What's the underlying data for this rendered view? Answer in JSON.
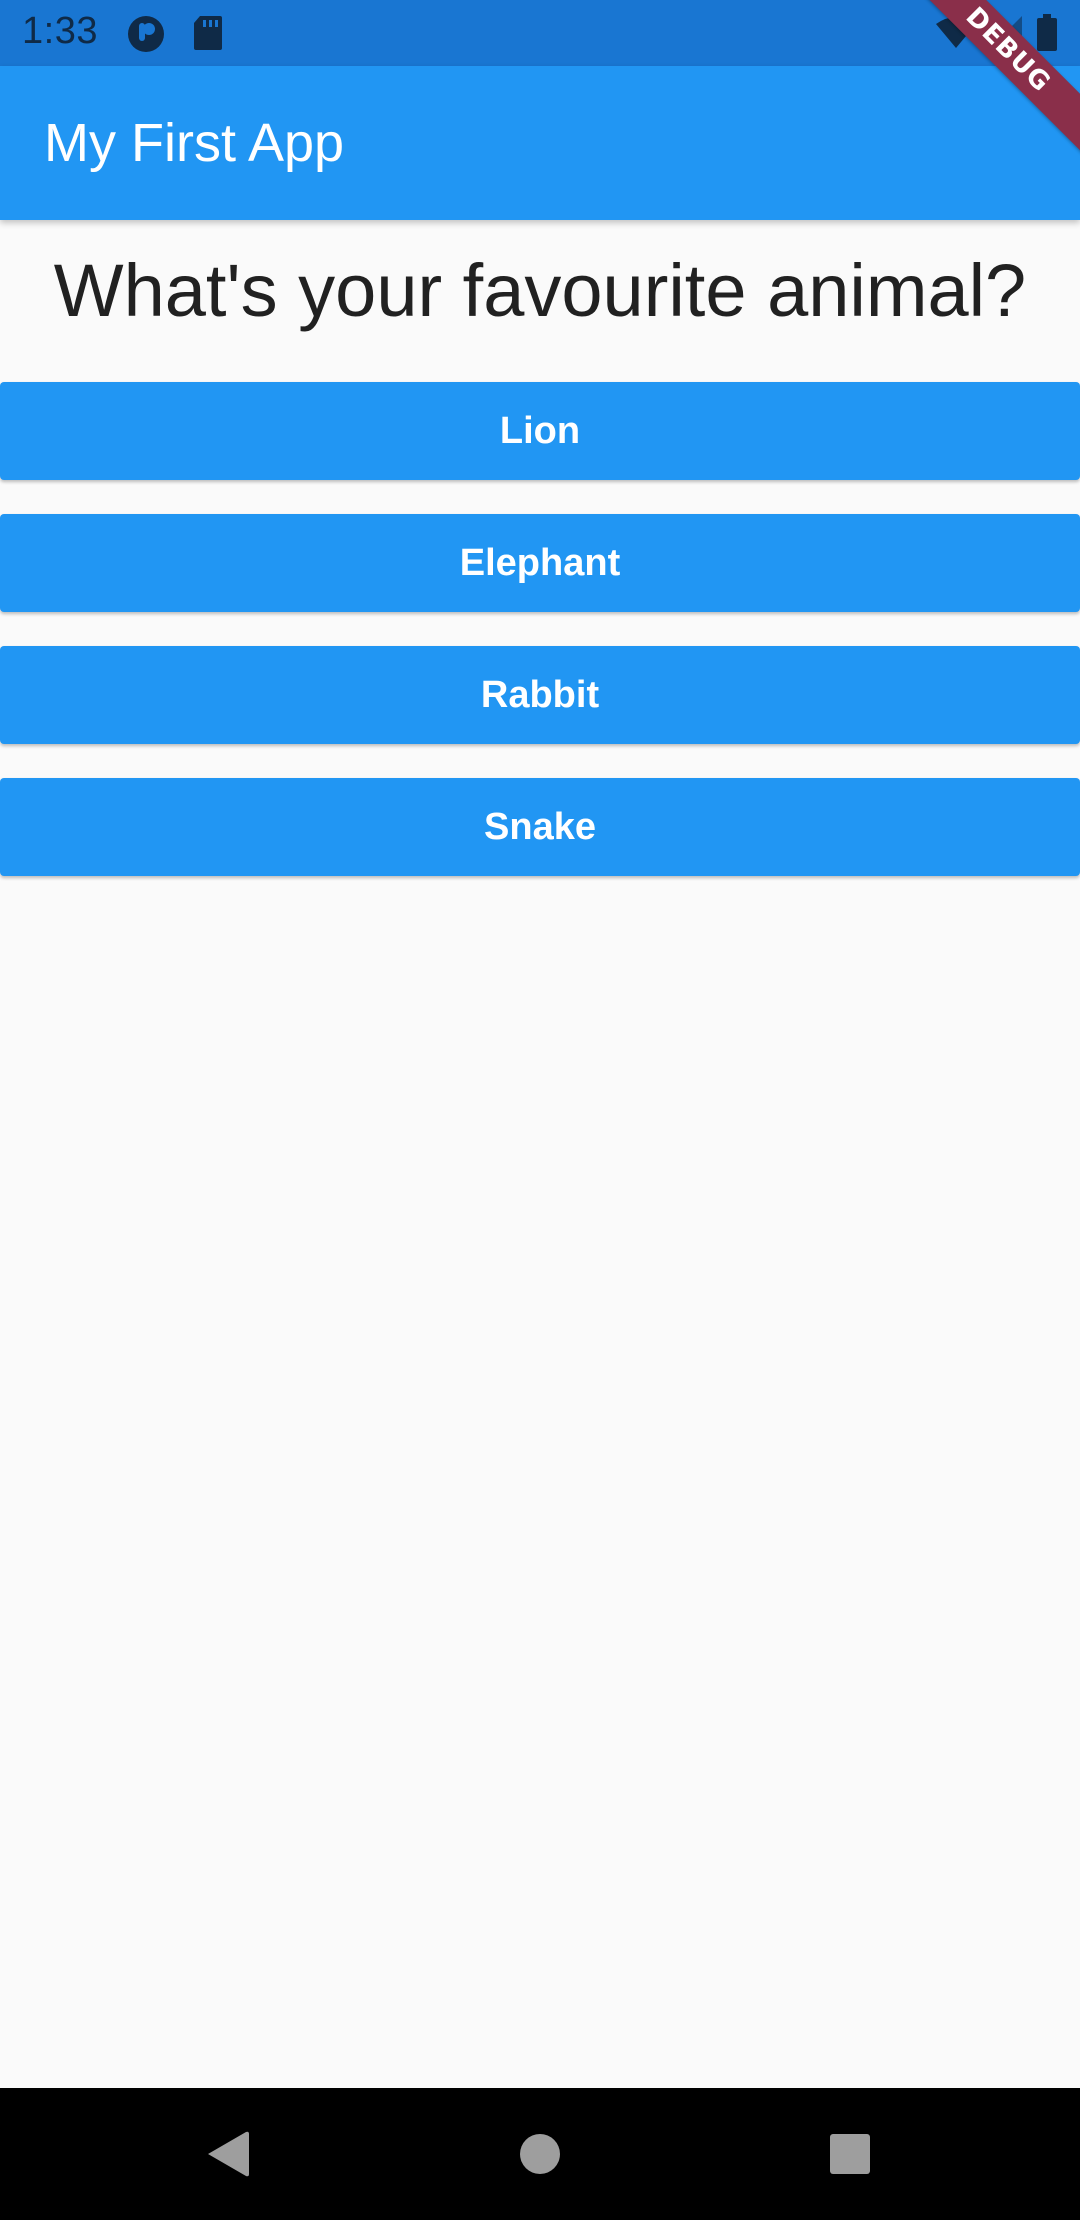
{
  "status_bar": {
    "time": "1:33",
    "icons": [
      "app-notification-icon",
      "sd-card-icon",
      "wifi-icon",
      "signal-icon",
      "battery-icon"
    ]
  },
  "app_bar": {
    "title": "My First App",
    "color": "#2196f3"
  },
  "debug_banner": {
    "label": "DEBUG",
    "color": "#8a2f4a"
  },
  "main": {
    "question": "What's your favourite animal?",
    "answers": [
      "Lion",
      "Elephant",
      "Rabbit",
      "Snake"
    ],
    "button_color": "#2196f3"
  },
  "nav_bar": {
    "icons": [
      "back-icon",
      "home-icon",
      "recents-icon"
    ]
  }
}
